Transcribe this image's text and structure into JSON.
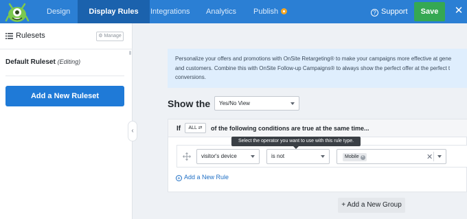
{
  "nav": {
    "tabs": [
      {
        "label": "Design"
      },
      {
        "label": "Display Rules"
      },
      {
        "label": "Integrations"
      },
      {
        "label": "Analytics"
      },
      {
        "label": "Publish"
      }
    ],
    "support_label": "Support",
    "save_label": "Save",
    "close_symbol": "✕",
    "accent_color": "#2b7fd4",
    "active_tab_color": "#1b62ad",
    "save_color": "#35a853"
  },
  "sidebar": {
    "title": "Rulesets",
    "manage_label": "Manage",
    "ruleset_name": "Default Ruleset",
    "ruleset_state": "(Editing)",
    "add_ruleset_label": "Add a New Ruleset",
    "collapse_symbol": "‹"
  },
  "main": {
    "info_lines": [
      "Personalize your offers and promotions with OnSite Retargeting® to make your campaigns more effective at gene",
      "and customers. Combine this with OnSite Follow-up Campaigns® to always show the perfect offer at the perfect t",
      "conversions."
    ],
    "show_the_label": "Show the",
    "view_select_value": "Yes/No View",
    "if_label": "If",
    "all_label": "ALL ⇄",
    "conditions_text": "of the following conditions are true at the same time...",
    "tooltip": "Select the operator you want to use with this rule type.",
    "rule": {
      "type": "visitor's device",
      "operator": "is not",
      "value_chip": "Mobile",
      "chip_remove": "×",
      "clear_symbol": "✕"
    },
    "add_rule_label": "Add a New Rule",
    "add_group_label": "+ Add a New Group"
  }
}
